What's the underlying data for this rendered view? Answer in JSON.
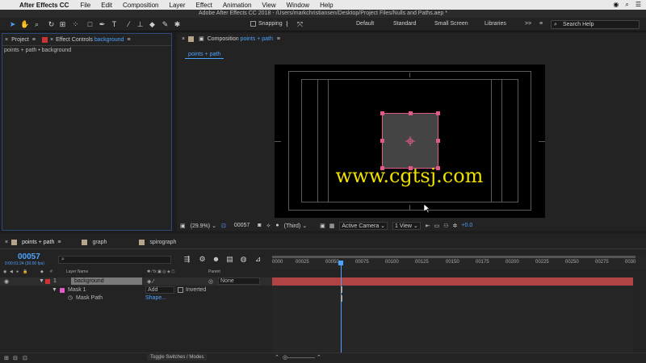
{
  "menubar": {
    "app_name": "After Effects CC",
    "items": [
      "File",
      "Edit",
      "Composition",
      "Layer",
      "Effect",
      "Animation",
      "View",
      "Window",
      "Help"
    ]
  },
  "window": {
    "title": "Adobe After Effects CC 2018 - /Users/markchristiansen/Desktop/Project Files/Nulls and Paths.aep *"
  },
  "toolbar": {
    "snapping_label": "Snapping",
    "workspaces": [
      "Default",
      "Standard",
      "Small Screen",
      "Libraries"
    ],
    "more": ">>",
    "search_placeholder": "Search Help"
  },
  "left_panel": {
    "tab_project": "Project",
    "tab_effect_controls_prefix": "Effect Controls",
    "tab_effect_controls_layer": "background",
    "breadcrumb": "points + path • background"
  },
  "comp_panel": {
    "tab_prefix": "Composition",
    "tab_name": "points + path",
    "sub_tab": "points + path",
    "watermark": "www.cgtsj.com",
    "footer": {
      "zoom": "(29.9%)",
      "timecode": "00057",
      "resolution": "(Third)",
      "camera": "Active Camera",
      "views": "1 View",
      "exposure": "+0.0"
    }
  },
  "timeline": {
    "tabs": [
      {
        "label": "points + path",
        "color": "#b7a48a"
      },
      {
        "label": "graph",
        "color": "#b7a48a"
      },
      {
        "label": "spirograph",
        "color": "#b7a48a"
      }
    ],
    "current_time": "00057",
    "current_time_sub": "0:00:01:24 (30.00 fps)",
    "search_placeholder": "",
    "col_layer_name": "Layer Name",
    "col_parent": "Parent",
    "ruler_labels": [
      "0000",
      "00025",
      "00050",
      "00075",
      "00100",
      "00125",
      "00150",
      "00175",
      "00200",
      "00225",
      "00250",
      "00275",
      "0030"
    ],
    "layer": {
      "index": "1",
      "name": "background",
      "parent": "None"
    },
    "mask": {
      "name": "Mask 1",
      "mode": "Add",
      "inverted": "Inverted",
      "path_label": "Mask Path",
      "path_value": "Shape..."
    },
    "footer_label": "Toggle Switches / Modes",
    "playhead_fraction": 0.19,
    "work_area_end_fraction": 1.0
  }
}
